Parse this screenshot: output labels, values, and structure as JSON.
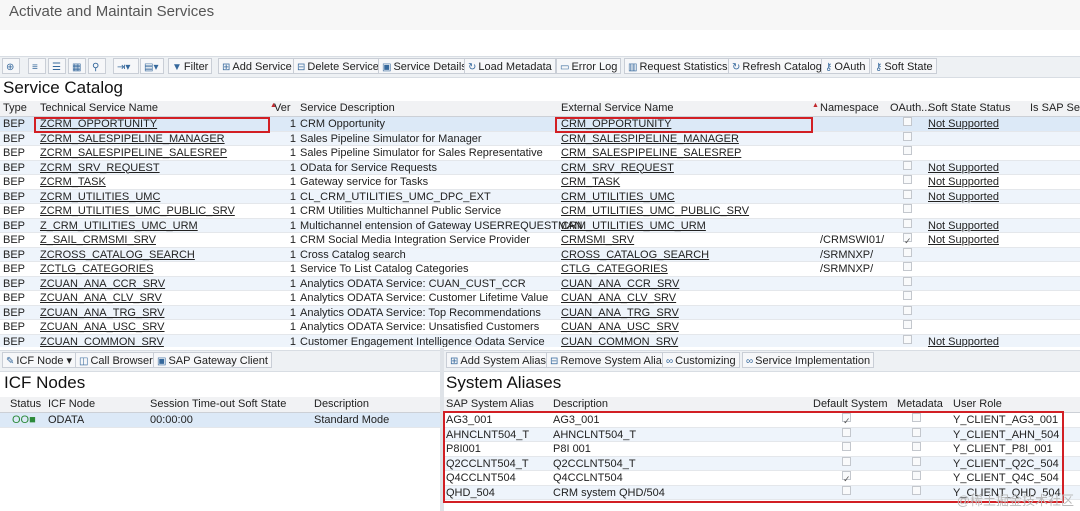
{
  "window": {
    "title": "Activate and Maintain Services"
  },
  "toolbar": {
    "filter": "Filter",
    "add_service": "Add Service",
    "delete_service": "Delete Service",
    "service_details": "Service Details",
    "load_metadata": "Load Metadata",
    "error_log": "Error Log",
    "request_statistics": "Request Statistics",
    "refresh_catalog": "Refresh Catalog",
    "oauth": "OAuth",
    "soft_state": "Soft State"
  },
  "catalog": {
    "title": "Service Catalog",
    "headers": [
      "Type",
      "Technical Service Name",
      "Ver",
      "Service Description",
      "External Service Name",
      "Namespace",
      "OAuth...",
      "Soft State Status",
      "Is SAP Serv"
    ],
    "rows": [
      {
        "type": "BEP",
        "name": "ZCRM_OPPORTUNITY",
        "ver": "1",
        "desc": "CRM Opportunity",
        "ext": "CRM_OPPORTUNITY",
        "ns": "",
        "oauth": false,
        "soft": "Not Supported"
      },
      {
        "type": "BEP",
        "name": "ZCRM_SALESPIPELINE_MANAGER",
        "ver": "1",
        "desc": "Sales Pipeline Simulator for Manager",
        "ext": "CRM_SALESPIPELINE_MANAGER",
        "ns": "",
        "oauth": false,
        "soft": ""
      },
      {
        "type": "BEP",
        "name": "ZCRM_SALESPIPELINE_SALESREP",
        "ver": "1",
        "desc": "Sales Pipeline Simulator for Sales Representative",
        "ext": "CRM_SALESPIPELINE_SALESREP",
        "ns": "",
        "oauth": false,
        "soft": ""
      },
      {
        "type": "BEP",
        "name": "ZCRM_SRV_REQUEST",
        "ver": "1",
        "desc": "OData for Service Requests",
        "ext": "CRM_SRV_REQUEST",
        "ns": "",
        "oauth": false,
        "soft": "Not Supported"
      },
      {
        "type": "BEP",
        "name": "ZCRM_TASK",
        "ver": "1",
        "desc": "Gateway service for Tasks",
        "ext": "CRM_TASK",
        "ns": "",
        "oauth": false,
        "soft": "Not Supported"
      },
      {
        "type": "BEP",
        "name": "ZCRM_UTILITIES_UMC",
        "ver": "1",
        "desc": "CL_CRM_UTILITIES_UMC_DPC_EXT",
        "ext": "CRM_UTILITIES_UMC",
        "ns": "",
        "oauth": false,
        "soft": "Not Supported"
      },
      {
        "type": "BEP",
        "name": "ZCRM_UTILITIES_UMC_PUBLIC_SRV",
        "ver": "1",
        "desc": "CRM Utilities Multichannel Public Service",
        "ext": "CRM_UTILITIES_UMC_PUBLIC_SRV",
        "ns": "",
        "oauth": false,
        "soft": ""
      },
      {
        "type": "BEP",
        "name": "Z_CRM_UTILITIES_UMC_URM",
        "ver": "1",
        "desc": "Multichannel entension of Gateway USERREQUESTMAN",
        "ext": "CRM_UTILITIES_UMC_URM",
        "ns": "",
        "oauth": false,
        "soft": "Not Supported"
      },
      {
        "type": "BEP",
        "name": "Z_SAIL_CRMSMI_SRV",
        "ver": "1",
        "desc": "CRM Social Media Integration Service Provider",
        "ext": "CRMSMI_SRV",
        "ns": "/CRMSWI01/",
        "oauth": true,
        "soft": "Not Supported"
      },
      {
        "type": "BEP",
        "name": "ZCROSS_CATALOG_SEARCH",
        "ver": "1",
        "desc": "Cross Catalog search",
        "ext": "CROSS_CATALOG_SEARCH",
        "ns": "/SRMNXP/",
        "oauth": false,
        "soft": ""
      },
      {
        "type": "BEP",
        "name": "ZCTLG_CATEGORIES",
        "ver": "1",
        "desc": "Service To List Catalog Categories",
        "ext": "CTLG_CATEGORIES",
        "ns": "/SRMNXP/",
        "oauth": false,
        "soft": ""
      },
      {
        "type": "BEP",
        "name": "ZCUAN_ANA_CCR_SRV",
        "ver": "1",
        "desc": "Analytics ODATA Service: CUAN_CUST_CCR",
        "ext": "CUAN_ANA_CCR_SRV",
        "ns": "",
        "oauth": false,
        "soft": ""
      },
      {
        "type": "BEP",
        "name": "ZCUAN_ANA_CLV_SRV",
        "ver": "1",
        "desc": "Analytics ODATA Service: Customer Lifetime Value",
        "ext": "CUAN_ANA_CLV_SRV",
        "ns": "",
        "oauth": false,
        "soft": ""
      },
      {
        "type": "BEP",
        "name": "ZCUAN_ANA_TRG_SRV",
        "ver": "1",
        "desc": "Analytics ODATA Service: Top Recommendations",
        "ext": "CUAN_ANA_TRG_SRV",
        "ns": "",
        "oauth": false,
        "soft": ""
      },
      {
        "type": "BEP",
        "name": "ZCUAN_ANA_USC_SRV",
        "ver": "1",
        "desc": "Analytics ODATA Service: Unsatisfied Customers",
        "ext": "CUAN_ANA_USC_SRV",
        "ns": "",
        "oauth": false,
        "soft": ""
      },
      {
        "type": "BEP",
        "name": "ZCUAN_COMMON_SRV",
        "ver": "1",
        "desc": "Customer Engagement Intelligence Odata Service",
        "ext": "CUAN_COMMON_SRV",
        "ns": "",
        "oauth": false,
        "soft": "Not Supported"
      }
    ]
  },
  "icf": {
    "toolbar": {
      "icf_node": "ICF Node",
      "call_browser": "Call Browser",
      "gateway_client": "SAP Gateway Client"
    },
    "title": "ICF Nodes",
    "headers": [
      "Status",
      "ICF Node",
      "Session Time-out Soft State",
      "Description"
    ],
    "rows": [
      {
        "status": "OO■",
        "node": "ODATA",
        "timeout": "00:00:00",
        "desc": "Standard Mode"
      }
    ]
  },
  "aliases": {
    "toolbar": {
      "add": "Add System Alias",
      "remove": "Remove System Alias",
      "customizing": "Customizing",
      "service_impl": "Service Implementation"
    },
    "title": "System Aliases",
    "headers": [
      "SAP System Alias",
      "Description",
      "Default System",
      "Metadata",
      "User Role"
    ],
    "rows": [
      {
        "alias": "AG3_001",
        "desc": "AG3_001",
        "default": true,
        "role": "Y_CLIENT_AG3_001"
      },
      {
        "alias": "AHNCLNT504_T",
        "desc": "AHNCLNT504_T",
        "default": false,
        "role": "Y_CLIENT_AHN_504"
      },
      {
        "alias": "P8I001",
        "desc": "P8I 001",
        "default": false,
        "role": "Y_CLIENT_P8I_001"
      },
      {
        "alias": "Q2CCLNT504_T",
        "desc": "Q2CCLNT504_T",
        "default": false,
        "role": "Y_CLIENT_Q2C_504"
      },
      {
        "alias": "Q4CCLNT504",
        "desc": "Q4CCLNT504",
        "default": true,
        "role": "Y_CLIENT_Q4C_504"
      },
      {
        "alias": "QHD_504",
        "desc": "CRM system QHD/504",
        "default": false,
        "role": "Y_CLIENT_QHD_504"
      }
    ]
  },
  "watermark": "@稀土掘金技术社区",
  "colors": {
    "highlight_row": "#dce9f7",
    "zebra": "#eef4fb",
    "red_box": "#d21f24"
  }
}
